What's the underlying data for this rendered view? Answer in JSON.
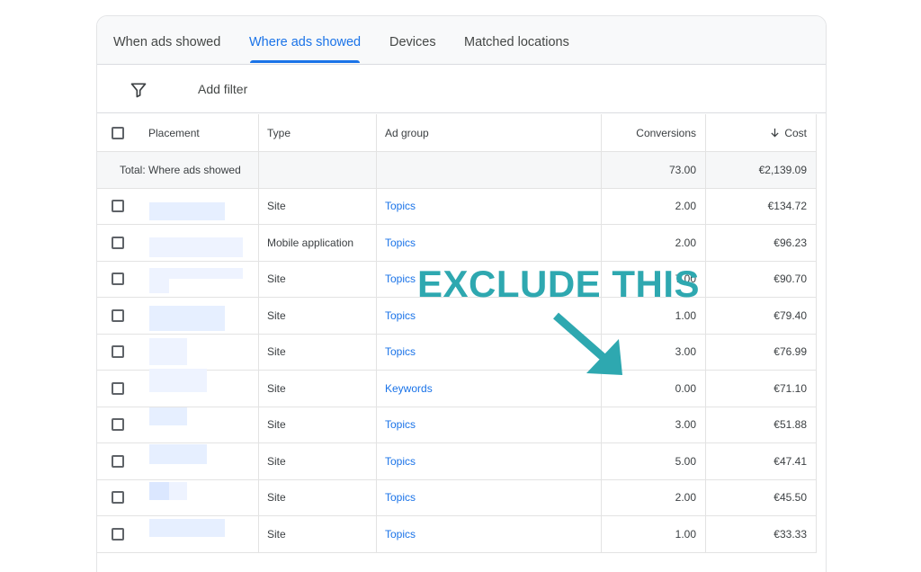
{
  "tabs": [
    {
      "label": "When ads showed",
      "active": false
    },
    {
      "label": "Where ads showed",
      "active": true
    },
    {
      "label": "Devices",
      "active": false
    },
    {
      "label": "Matched locations",
      "active": false
    }
  ],
  "filter": {
    "label": "Add filter",
    "icon": "filter-icon"
  },
  "columns": {
    "placement": "Placement",
    "type": "Type",
    "ad_group": "Ad group",
    "conversions": "Conversions",
    "cost": "Cost",
    "cost_sort_icon": "arrow-down-icon"
  },
  "total": {
    "label": "Total: Where ads showed",
    "conversions": "73.00",
    "cost": "€2,139.09"
  },
  "rows": [
    {
      "type": "Site",
      "ad_group": "Topics",
      "conversions": "2.00",
      "cost": "€134.72"
    },
    {
      "type": "Mobile application",
      "ad_group": "Topics",
      "conversions": "2.00",
      "cost": "€96.23"
    },
    {
      "type": "Site",
      "ad_group": "Topics",
      "conversions": "7.00",
      "cost": "€90.70"
    },
    {
      "type": "Site",
      "ad_group": "Topics",
      "conversions": "1.00",
      "cost": "€79.40"
    },
    {
      "type": "Site",
      "ad_group": "Topics",
      "conversions": "3.00",
      "cost": "€76.99"
    },
    {
      "type": "Site",
      "ad_group": "Keywords",
      "conversions": "0.00",
      "cost": "€71.10"
    },
    {
      "type": "Site",
      "ad_group": "Topics",
      "conversions": "3.00",
      "cost": "€51.88"
    },
    {
      "type": "Site",
      "ad_group": "Topics",
      "conversions": "5.00",
      "cost": "€47.41"
    },
    {
      "type": "Site",
      "ad_group": "Topics",
      "conversions": "2.00",
      "cost": "€45.50"
    },
    {
      "type": "Site",
      "ad_group": "Topics",
      "conversions": "1.00",
      "cost": "€33.33"
    }
  ],
  "annotation": {
    "text": "EXCLUDE THIS",
    "color": "#2ea8b0"
  },
  "colors": {
    "accent": "#1a73e8",
    "annotation": "#2ea8b0"
  }
}
